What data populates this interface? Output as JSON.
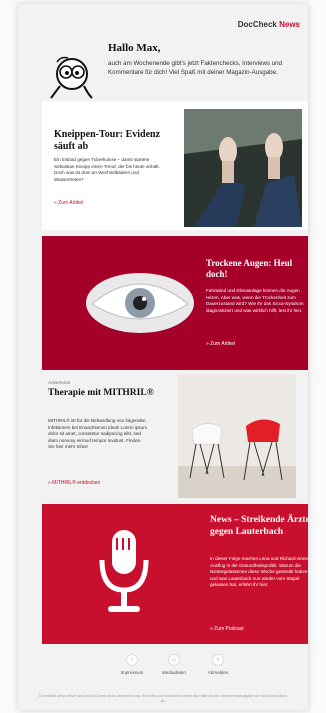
{
  "brand": {
    "name": "DocCheck",
    "suffix": "News"
  },
  "greeting": {
    "title": "Hallo Max,",
    "text": "auch am Wochenende gibt's jetzt Faktenchecks, Interviews und Kommentare für dich! Viel Spaß mit deiner Magazin-Ausgabe."
  },
  "articles": [
    {
      "title": "Kneippen-Tour: Evidenz säuft ab",
      "text": "Ein Eisbad gegen Tuberkulose – damit startete Sebastian Kneipp einen Trend, der bis heute anhält. Doch was ist dran an Wechselbädern und Wassertreten?",
      "link": "» Zum Artikel"
    },
    {
      "title": "Trockene Augen: Heul doch!",
      "text": "Fahrtwind und Klimaanlage können die Augen reizen. Aber was, wenn die Trockenheit zum Dauerzustand wird? Wie ihr das Sicca-Syndrom diagnostiziert und was wirklich hilft, lest ihr hier.",
      "link": "» Zum Artikel"
    },
    {
      "label": "Advertorial",
      "title": "Therapie mit MITHRIL®",
      "text": "MITHRIL® ist für die Behandlung von folgenden Infektionen bei Erwachsenen ideal! Lorem ipsum dolor sit amet, consetetur sadipscing elitr, sed diam nonumy eirmod tempor invidunt. Finden Sie hier mehr Infos!",
      "link": "» MITHRIL® entdecken"
    },
    {
      "title": "News – Streikende Ärzte gegen Lauterbach",
      "text": "In dieser Folge machen Lena und Richard einen Ausflug in die Gesundheitspolitik. Warum die Niedergelassenen diese Woche gestreikt haben und was Lauterbach nun wieder vom Stapel gelassen hat, erfahrt ihr hier.",
      "link": "» Zum Podcast"
    }
  ],
  "footer": {
    "links": [
      {
        "label": "Impressum",
        "icon": "info-icon"
      },
      {
        "label": "Mediadaten",
        "icon": "monitor-icon"
      },
      {
        "label": "Abmelden",
        "icon": "close-icon"
      }
    ],
    "text": "Du erhältst diese eMail, weil du DocCheck News abonniert hast. Bei Kritik und Wünschen melde dich bitte bei der Wochenendausgabe der DocCheck News ab."
  },
  "colors": {
    "accent": "#c8102e",
    "dark_accent": "#a50029"
  }
}
